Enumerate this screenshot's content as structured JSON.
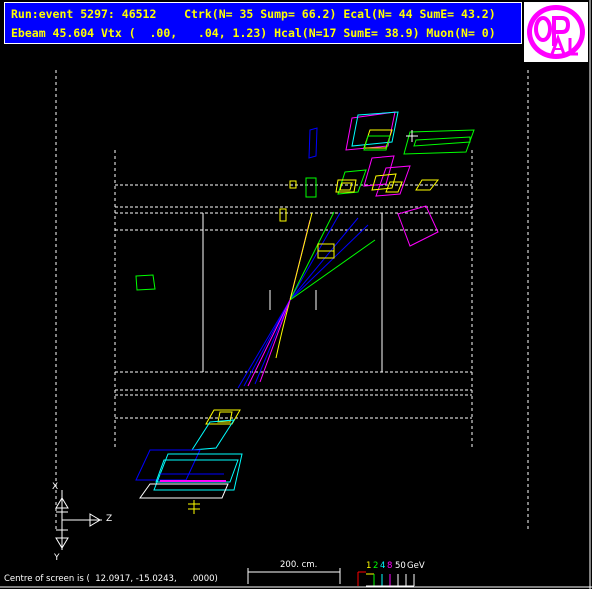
{
  "header": {
    "line1": "Run:event 5297: 46512    Ctrk(N= 35 Sump= 66.2) Ecal(N= 44 SumE= 43.2)",
    "line2": "Ebeam 45.604 Vtx (  .00,   .04, 1.23) Hcal(N=17 SumE= 38.9) Muon(N= 0)"
  },
  "logo": {
    "name": "opal-logo",
    "letters": "OPAL"
  },
  "footer": {
    "centre_text": "Centre of screen is (  12.0917, -15.0243,     .0000)"
  },
  "scale": {
    "label": "200. cm."
  },
  "energy_scale": {
    "values": [
      "1",
      "2",
      "4",
      "8",
      "50"
    ],
    "unit": "GeV",
    "colors": [
      "#ffff00",
      "#00ff00",
      "#00ffff",
      "#ff00ff",
      "#ffffff"
    ]
  },
  "axes": {
    "x": "X",
    "z": "Z",
    "y": "Y"
  },
  "colors": {
    "background": "#000000",
    "header_bg": "#0000ff",
    "header_text": "#ffff00",
    "logo_ring": "#ff00ff",
    "detector_lines": "#ffffff",
    "track_blue": "#0000ff",
    "track_green": "#00ff00",
    "track_yellow": "#ffff00",
    "ecal": "#ffff00",
    "hcal": "#ff00ff",
    "muon": "#00ffff"
  }
}
